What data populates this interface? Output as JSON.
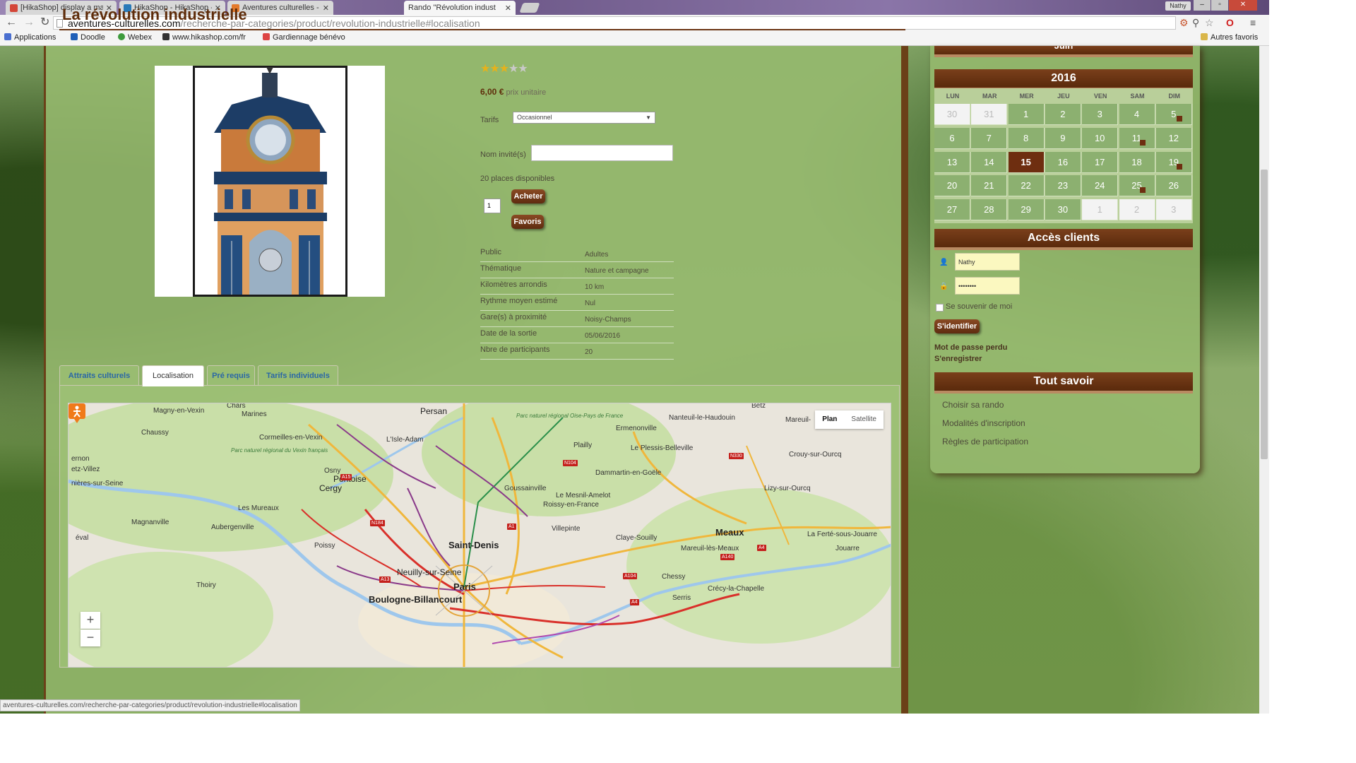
{
  "browser": {
    "tabs": [
      {
        "label": "[HikaShop] display a map"
      },
      {
        "label": "HikaShop - HikaShop - Re"
      },
      {
        "label": "Aventures culturelles - Ad"
      },
      {
        "label": "Rando \"Révolution indust"
      }
    ],
    "user_badge": "Nathy",
    "url_host": "aventures-culturelles.com",
    "url_path": "/recherche-par-categories/product/revolution-industrielle#localisation",
    "bookmarks": [
      {
        "label": "Applications"
      },
      {
        "label": "Doodle"
      },
      {
        "label": "Webex"
      },
      {
        "label": "www.hikashop.com/fr"
      },
      {
        "label": "Gardiennage bénévo"
      }
    ],
    "other_bookmarks": "Autres favoris",
    "status_url": "aventures-culturelles.com/recherche-par-categories/product/revolution-industrielle#localisation"
  },
  "product": {
    "title": "La révolution industrielle",
    "rating_filled": 3,
    "rating_max": 5,
    "price": "6,00 €",
    "price_suffix": "prix unitaire",
    "tarif_label": "Tarifs",
    "tarif_value": "Occasionnel",
    "guest_label": "Nom invité(s)",
    "places": "20 places disponibles",
    "qty": "1",
    "buy_label": "Acheter",
    "fav_label": "Favoris",
    "specs": [
      {
        "k": "Public",
        "v": "Adultes"
      },
      {
        "k": "Thématique",
        "v": "Nature et campagne"
      },
      {
        "k": "Kilomètres arrondis",
        "v": "10 km"
      },
      {
        "k": "Rythme moyen estimé",
        "v": "Nul"
      },
      {
        "k": "Gare(s) à proximité",
        "v": "Noisy-Champs"
      },
      {
        "k": "Date de la sortie",
        "v": "05/06/2016"
      },
      {
        "k": "Nbre de participants",
        "v": "20"
      }
    ]
  },
  "tabs": [
    "Attraits culturels",
    "Localisation",
    "Pré requis",
    "Tarifs individuels"
  ],
  "map": {
    "toggle_plan": "Plan",
    "toggle_satellite": "Satellite",
    "zoom_in": "+",
    "zoom_out": "−",
    "labels": {
      "magny": "Magny-en-Vexin",
      "marines": "Marines",
      "chars": "Chars",
      "persan": "Persan",
      "chaussy": "Chaussy",
      "cormeilles": "Cormeilles-en-Vexin",
      "lisle": "L'Isle-Adam",
      "parc_oise": "Parc naturel régional Oise-Pays de France",
      "emenonville": "Ermenonville",
      "nanteuil": "Nanteuil-le-Haudouin",
      "betz": "Betz",
      "mareuil_top": "Mareuil-",
      "vexin_parc": "Parc naturel régional du Vexin français",
      "plailly": "Plailly",
      "plessis": "Le Plessis-Belleville",
      "crouy": "Crouy-sur-Ourcq",
      "vernon": "ernon",
      "villez": "etz-Villez",
      "bonnieres": "nières-sur-Seine",
      "osny": "Osny",
      "pontoise": "Pontoise",
      "cergy": "Cergy",
      "dammartin": "Dammartin-en-Goële",
      "goussainville": "Goussainville",
      "mesnil": "Le Mesnil-Amelot",
      "roissy": "Roissy-en-France",
      "lizy": "Lizy-sur-Ourcq",
      "mureaux": "Les Mureaux",
      "magnanville": "Magnanville",
      "aubergenville": "Aubergenville",
      "villepinte": "Villepinte",
      "meaux": "Meaux",
      "ferte": "La Ferté-sous-Jouarre",
      "jouarre": "Jouarre",
      "eval": "éval",
      "saint_denis": "Saint-Denis",
      "claye": "Claye-Souilly",
      "poissy": "Poissy",
      "mareuil_meaux": "Mareuil-lès-Meaux",
      "neuilly": "Neuilly-sur-Seine",
      "paris": "Paris",
      "chessy": "Chessy",
      "houdan": "Thoiry",
      "crecy": "Crécy-la-Chapelle",
      "boulogne": "Boulogne-Billancourt",
      "serris": "Serris"
    }
  },
  "sidebar": {
    "cal_year": "2016",
    "cal_top_fragment": "Juin",
    "weekdays": [
      "LUN",
      "MAR",
      "MER",
      "JEU",
      "VEN",
      "SAM",
      "DIM"
    ],
    "days": [
      {
        "d": "30",
        "t": "other"
      },
      {
        "d": "31",
        "t": "other"
      },
      {
        "d": "1"
      },
      {
        "d": "2"
      },
      {
        "d": "3"
      },
      {
        "d": "4"
      },
      {
        "d": "5",
        "e": true
      },
      {
        "d": "6"
      },
      {
        "d": "7"
      },
      {
        "d": "8"
      },
      {
        "d": "9"
      },
      {
        "d": "10"
      },
      {
        "d": "11",
        "e": true
      },
      {
        "d": "12"
      },
      {
        "d": "13"
      },
      {
        "d": "14"
      },
      {
        "d": "15",
        "t": "today"
      },
      {
        "d": "16"
      },
      {
        "d": "17"
      },
      {
        "d": "18"
      },
      {
        "d": "19",
        "e": true
      },
      {
        "d": "20"
      },
      {
        "d": "21"
      },
      {
        "d": "22"
      },
      {
        "d": "23"
      },
      {
        "d": "24"
      },
      {
        "d": "25",
        "e": true
      },
      {
        "d": "26"
      },
      {
        "d": "27"
      },
      {
        "d": "28"
      },
      {
        "d": "29"
      },
      {
        "d": "30"
      },
      {
        "d": "1",
        "t": "other"
      },
      {
        "d": "2",
        "t": "other"
      },
      {
        "d": "3",
        "t": "other"
      }
    ],
    "access_title": "Accès clients",
    "username": "Nathy",
    "password": "••••••••",
    "remember": "Se souvenir de moi",
    "login_btn": "S'identifier",
    "forgot": "Mot de passe perdu",
    "register": "S'enregistrer",
    "know_title": "Tout savoir",
    "links": [
      "Choisir sa rando",
      "Modalités d'inscription",
      "Règles de participation"
    ]
  }
}
